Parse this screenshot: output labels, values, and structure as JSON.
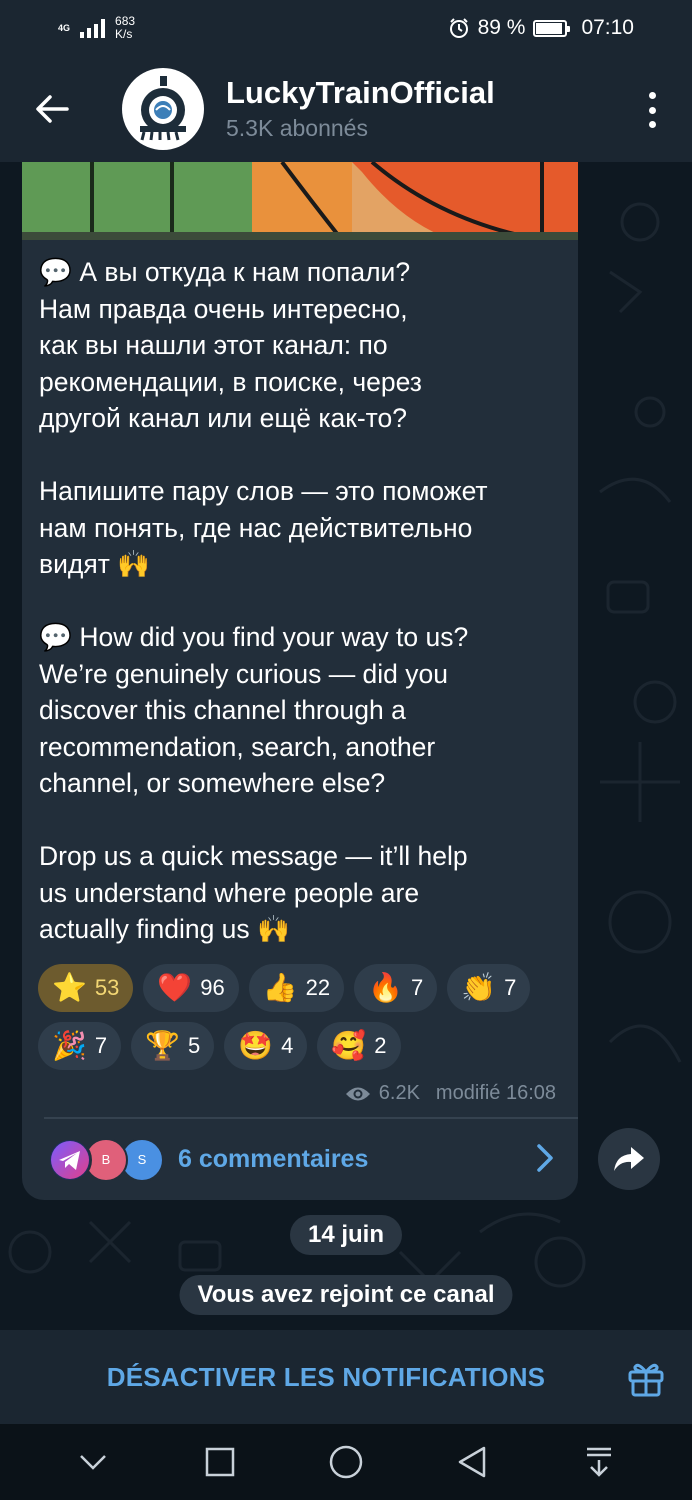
{
  "status_bar": {
    "network": "4G",
    "speed_value": "683",
    "speed_unit": "K/s",
    "battery": "89 %",
    "time": "07:10"
  },
  "header": {
    "title": "LuckyTrainOfficial",
    "subtitle": "5.3K abonnés"
  },
  "post": {
    "text": "💬 А вы откуда к нам попали?\nНам правда очень интересно,\nкак вы нашли этот канал: по\nрекомендации, в поиске, через\nдругой канал или ещё как-то?\n\nНапишите пару слов — это поможет\nнам понять, где нас действительно\nвидят 🙌\n\n💬 How did you find your way to us?\nWe’re genuinely curious — did you\ndiscover this channel through a\nrecommendation, search, another\nchannel, or somewhere else?\n\nDrop us a quick message — it’ll help\nus understand where people are\nactually finding us 🙌",
    "reactions_row1": [
      {
        "emoji": "⭐",
        "count": "53"
      },
      {
        "emoji": "❤️",
        "count": "96"
      },
      {
        "emoji": "👍",
        "count": "22"
      },
      {
        "emoji": "🔥",
        "count": "7"
      },
      {
        "emoji": "👏",
        "count": "7"
      }
    ],
    "reactions_row2": [
      {
        "emoji": "🎉",
        "count": "7"
      },
      {
        "emoji": "🏆",
        "count": "5"
      },
      {
        "emoji": "🤩",
        "count": "4"
      },
      {
        "emoji": "🥰",
        "count": "2"
      }
    ],
    "views": "6.2K",
    "edited": "modifié 16:08",
    "comment_avatars": [
      "B",
      "S"
    ],
    "comments_label": "6 commentaires"
  },
  "chat": {
    "date_pill": "14 juin",
    "service_message": "Vous avez rejoint ce canal"
  },
  "bottom_bar": {
    "mute_label": "DÉSACTIVER LES NOTIFICATIONS"
  },
  "colors": {
    "accent": "#5fa8e6",
    "bubble": "#222e3a",
    "header": "#1b2631",
    "active_reaction": "#6d5b2e"
  },
  "icons": [
    "back-arrow-icon",
    "more-vert-icon",
    "eye-icon",
    "chevron-right-icon",
    "share-icon",
    "gift-icon",
    "alarm-icon",
    "battery-icon"
  ]
}
